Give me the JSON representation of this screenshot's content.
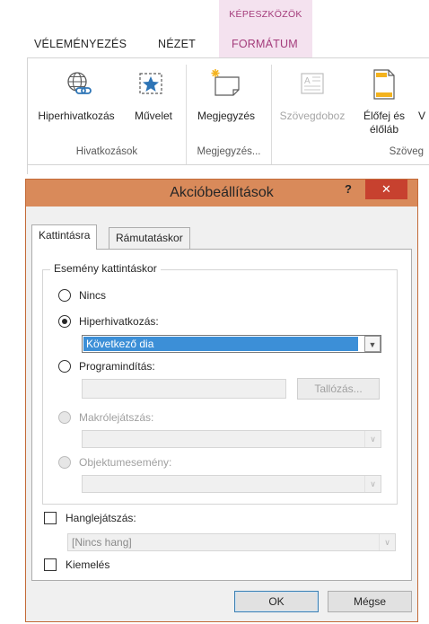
{
  "ribbon": {
    "contextual_group": "KÉPESZKÖZÖK",
    "tabs": [
      "VÉLEMÉNYEZÉS",
      "NÉZET",
      "FORMÁTUM"
    ],
    "buttons": {
      "hyperlink": "Hiperhivatkozás",
      "action": "Művelet",
      "comment": "Megjegyzés",
      "textbox": "Szövegdoboz",
      "header_line1": "Élőfej és",
      "header_line2": "élőláb",
      "cut_char": "V"
    },
    "groups": {
      "links": "Hivatkozások",
      "comments": "Megjegyzés...",
      "text": "Szöveg"
    },
    "colors": {
      "contextual_accent": "#a43c7b",
      "contextual_band": "#f4e2ef"
    }
  },
  "dialog": {
    "title": "Akcióbeállítások",
    "help": "?",
    "close": "✕",
    "tabs": {
      "click": "Kattintásra",
      "hover": "Rámutatáskor"
    },
    "group_label": "Esemény kattintáskor",
    "options": {
      "none": "Nincs",
      "hyperlink": "Hiperhivatkozás:",
      "hyperlink_value": "Következő dia",
      "run_program": "Programindítás:",
      "browse": "Tallózás...",
      "run_macro": "Makrólejátszás:",
      "object_action": "Objektumesemény:"
    },
    "sound": {
      "label": "Hanglejátszás:",
      "value": "[Nincs hang]"
    },
    "highlight": "Kiemelés",
    "ok": "OK",
    "cancel": "Mégse",
    "colors": {
      "titlebar": "#d98a5a",
      "close_button": "#c7412f",
      "selection": "#3c8fd7"
    }
  }
}
